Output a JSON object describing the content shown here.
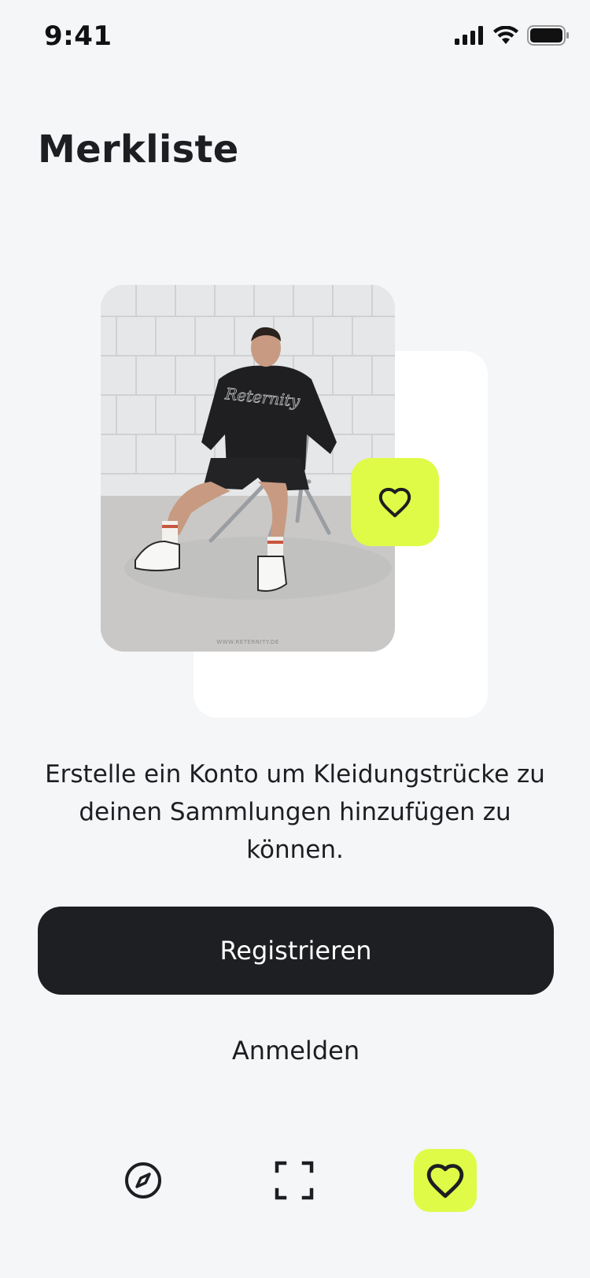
{
  "status_bar": {
    "time": "9:41"
  },
  "header": {
    "title": "Merkliste"
  },
  "illustration": {
    "watermark": "WWW.RETERNITY.DE",
    "hoodie_print": "Reternity",
    "accent_color": "#dffb47"
  },
  "message": {
    "text": "Erstelle ein Konto um Kleidungstrücke zu deinen Sammlungen hinzufügen zu können."
  },
  "actions": {
    "register_label": "Registrieren",
    "login_label": "Anmelden"
  },
  "bottom_nav": {
    "items": [
      {
        "icon": "compass-icon",
        "active": false
      },
      {
        "icon": "scan-frame-icon",
        "active": false
      },
      {
        "icon": "heart-icon",
        "active": true
      }
    ]
  },
  "colors": {
    "background": "#f4f6f8",
    "primary_button": "#1e1f22",
    "accent": "#dffb47"
  }
}
